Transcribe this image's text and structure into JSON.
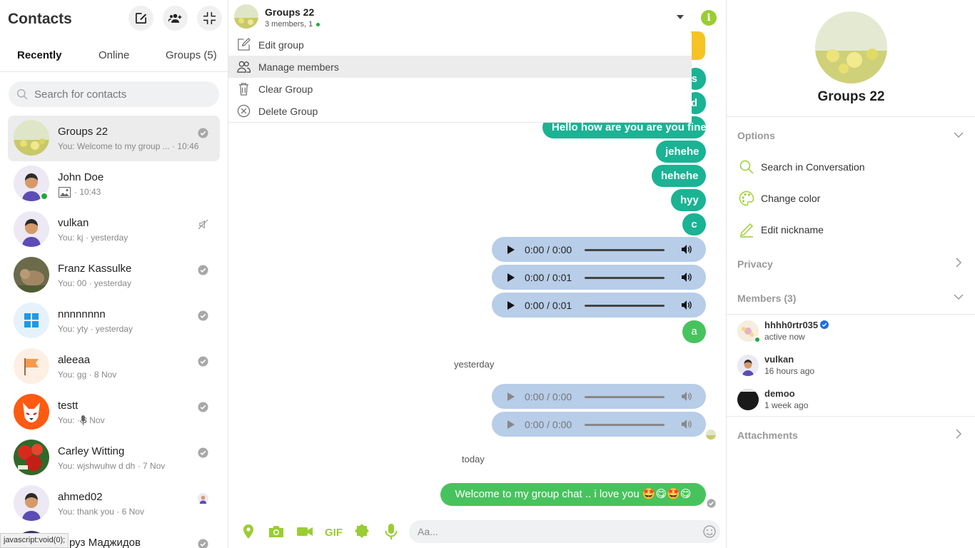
{
  "sidebar": {
    "title": "Contacts",
    "tabs": [
      "Recently",
      "Online",
      "Groups (5)"
    ],
    "search_placeholder": "Search for contacts",
    "contacts": [
      {
        "name": "Groups 22",
        "preview": "You: Welcome to my group ... · 10:46"
      },
      {
        "name": "John Doe",
        "preview": "· 10:43"
      },
      {
        "name": "vulkan",
        "preview": "You: kj · yesterday"
      },
      {
        "name": "Franz Kassulke",
        "preview": "You: 00 · yesterday"
      },
      {
        "name": "nnnnnnnn",
        "preview": "You: yty · yesterday"
      },
      {
        "name": "aleeaa",
        "preview": "You: gg · 8 Nov"
      },
      {
        "name": "testt",
        "preview": "You:    · 8 Nov"
      },
      {
        "name": "Carley Witting",
        "preview": "You: wjshwuhw d dh · 7 Nov"
      },
      {
        "name": "ahmed02",
        "preview": "You: thank you · 6 Nov"
      },
      {
        "name": "руз Маджидов",
        "preview": ""
      }
    ],
    "status_tip": "javascript:void(0);"
  },
  "chat": {
    "title": "Groups 22",
    "subtitle": "3 members, 1",
    "menu": [
      "Edit group",
      "Manage members",
      "Clear Group",
      "Delete Group"
    ],
    "partial_bubbles": [
      "s",
      "d"
    ],
    "messages": [
      "Hello how are you are you fine",
      "jehehe",
      "hehehe",
      "hyy",
      "c",
      "a"
    ],
    "audio": [
      {
        "time": "0:00 / 0:00"
      },
      {
        "time": "0:00 / 0:01"
      },
      {
        "time": "0:00 / 0:01"
      },
      {
        "time": "0:00 / 0:00"
      },
      {
        "time": "0:00 / 0:00"
      }
    ],
    "day_yesterday": "yesterday",
    "day_today": "today",
    "last_message": "Welcome to my group chat .. i love you 🤩😋🤩😋",
    "input_placeholder": "Aa...",
    "accent": "#9acd32"
  },
  "info": {
    "group_name": "Groups 22",
    "options_label": "Options",
    "options": [
      "Search in Conversation",
      "Change color",
      "Edit nickname"
    ],
    "privacy_label": "Privacy",
    "members_label": "Members (3)",
    "members": [
      {
        "name": "hhhh0rtr035",
        "sub": "active now"
      },
      {
        "name": "vulkan",
        "sub": "16 hours ago"
      },
      {
        "name": "demoo",
        "sub": "1 week ago"
      }
    ],
    "attachments_label": "Attachments"
  }
}
